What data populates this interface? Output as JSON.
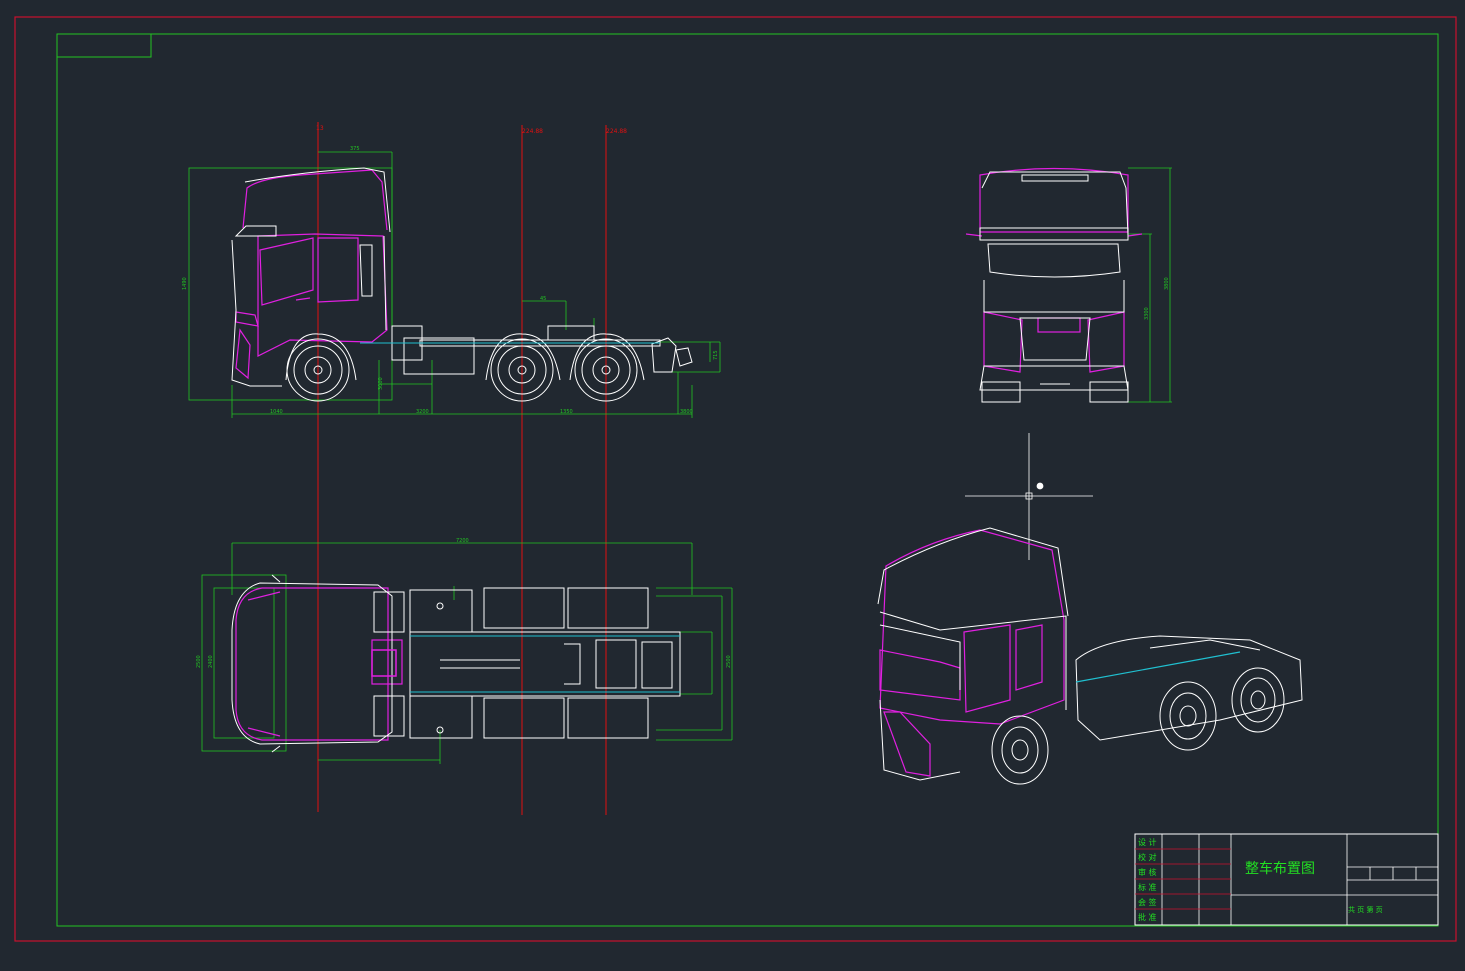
{
  "drawing": {
    "title": "整车布置图",
    "colors": {
      "background": "#212830",
      "outer_border": "#c8102e",
      "inner_border": "#22c322",
      "dimension": "#22c322",
      "centerline": "#e01010",
      "outline": "#ffffff",
      "cab": "#e020e0",
      "frame": "#20c0d0",
      "title_text": "#22e022"
    },
    "title_block": {
      "rows": [
        "设 计",
        "校 对",
        "审 核",
        "标 准",
        "会 签",
        "批 准"
      ],
      "note": "共 页 第 页"
    },
    "centerline_labels": [
      "13",
      "224.88",
      "224.88"
    ],
    "dimension_labels": {
      "side": [
        "1490",
        "3200",
        "1350",
        "1040",
        "3000",
        "3800",
        "715",
        "375",
        "45"
      ],
      "top": [
        "7200",
        "2500",
        "2400",
        "2500"
      ],
      "front": [
        "3800",
        "3300"
      ]
    },
    "views": [
      "side-view",
      "top-view",
      "front-view",
      "iso-view"
    ]
  }
}
